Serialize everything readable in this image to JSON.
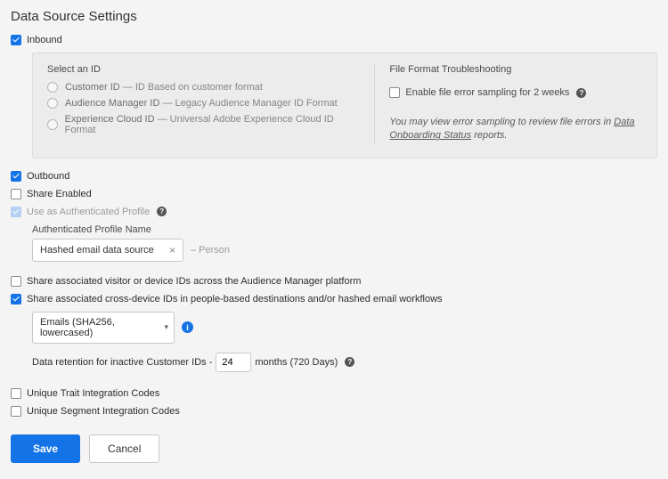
{
  "title": "Data Source Settings",
  "inbound": {
    "label": "Inbound",
    "checked": true
  },
  "idPanel": {
    "heading": "Select an ID",
    "options": [
      {
        "strong": "Customer ID",
        "rest": " — ID Based on customer format"
      },
      {
        "strong": "Audience Manager ID",
        "rest": " — Legacy Audience Manager ID Format"
      },
      {
        "strong": "Experience Cloud ID",
        "rest": " — Universal Adobe Experience Cloud ID Format"
      }
    ]
  },
  "troubleshoot": {
    "heading": "File Format Troubleshooting",
    "enableLabel": "Enable file error sampling for 2 weeks",
    "notePrefix": "You may view error sampling to review file errors in ",
    "noteLink": "Data Onboarding Status",
    "noteSuffix": " reports."
  },
  "outbound": {
    "label": "Outbound",
    "checked": true
  },
  "shareEnabled": {
    "label": "Share Enabled",
    "checked": false
  },
  "authProfile": {
    "label": "Use as Authenticated Profile",
    "checked": true,
    "locked": true
  },
  "profileName": {
    "label": "Authenticated Profile Name",
    "value": "Hashed email data source",
    "suffix": "– Person"
  },
  "shareVisitor": {
    "label": "Share associated visitor or device IDs across the Audience Manager platform",
    "checked": false
  },
  "shareCross": {
    "label": "Share associated cross-device IDs in people-based destinations and/or hashed email workflows",
    "checked": true
  },
  "hashSelect": {
    "value": "Emails (SHA256, lowercased)"
  },
  "retention": {
    "prefix": "Data retention for inactive Customer IDs -",
    "value": "24",
    "suffix": "months (720 Days)"
  },
  "uniqueTrait": {
    "label": "Unique Trait Integration Codes",
    "checked": false
  },
  "uniqueSegment": {
    "label": "Unique Segment Integration Codes",
    "checked": false
  },
  "actions": {
    "save": "Save",
    "cancel": "Cancel"
  }
}
